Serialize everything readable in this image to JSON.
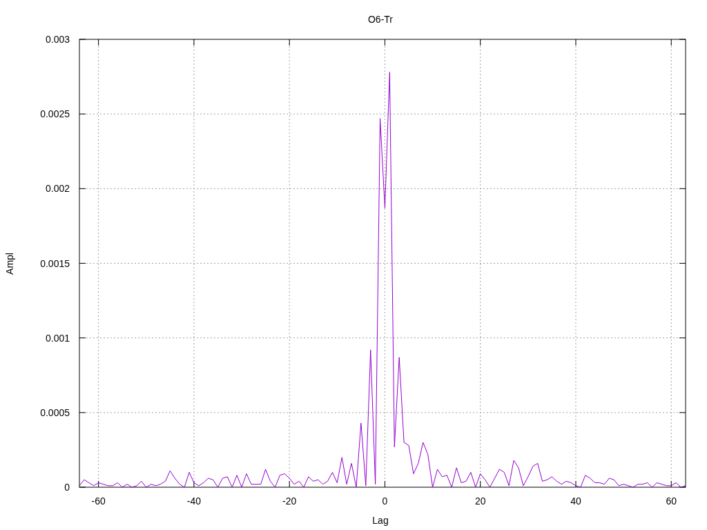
{
  "chart": {
    "chart_data": {
      "type": "line",
      "title": "O6-Tr",
      "xlabel": "Lag",
      "ylabel": "Ampl",
      "grid": true,
      "xlim": [
        -64,
        63
      ],
      "ylim": [
        0,
        0.003
      ],
      "xticks": [
        -60,
        -40,
        -20,
        0,
        20,
        40,
        60
      ],
      "yticks": [
        {
          "value": 0,
          "label": "0"
        },
        {
          "value": 0.0005,
          "label": "0.0005"
        },
        {
          "value": 0.001,
          "label": "0.001"
        },
        {
          "value": 0.0015,
          "label": "0.0015"
        },
        {
          "value": 0.002,
          "label": "0.002"
        },
        {
          "value": 0.0025,
          "label": "0.0025"
        },
        {
          "value": 0.003,
          "label": "0.003"
        }
      ],
      "x": [
        -64,
        -63,
        -62,
        -61,
        -60,
        -59,
        -58,
        -57,
        -56,
        -55,
        -54,
        -53,
        -52,
        -51,
        -50,
        -49,
        -48,
        -47,
        -46,
        -45,
        -44,
        -43,
        -42,
        -41,
        -40,
        -39,
        -38,
        -37,
        -36,
        -35,
        -34,
        -33,
        -32,
        -31,
        -30,
        -29,
        -28,
        -27,
        -26,
        -25,
        -24,
        -23,
        -22,
        -21,
        -20,
        -19,
        -18,
        -17,
        -16,
        -15,
        -14,
        -13,
        -12,
        -11,
        -10,
        -9,
        -8,
        -7,
        -6,
        -5,
        -4,
        -3,
        -2,
        -1,
        0,
        1,
        2,
        3,
        4,
        5,
        6,
        7,
        8,
        9,
        10,
        11,
        12,
        13,
        14,
        15,
        16,
        17,
        18,
        19,
        20,
        21,
        22,
        23,
        24,
        25,
        26,
        27,
        28,
        29,
        30,
        31,
        32,
        33,
        34,
        35,
        36,
        37,
        38,
        39,
        40,
        41,
        42,
        43,
        44,
        45,
        46,
        47,
        48,
        49,
        50,
        51,
        52,
        53,
        54,
        55,
        56,
        57,
        58,
        59,
        60,
        61,
        62,
        63
      ],
      "series": [
        {
          "color": "#9400d3",
          "values": [
            1e-05,
            5e-05,
            3e-05,
            1e-05,
            3e-05,
            2e-05,
            1e-05,
            1e-05,
            3e-05,
            0,
            2e-05,
            0,
            1e-05,
            4e-05,
            0,
            2e-05,
            1e-05,
            2e-05,
            4e-05,
            0.00011,
            6e-05,
            2e-05,
            0,
            0.0001,
            3e-05,
            1e-05,
            3e-05,
            6e-05,
            5e-05,
            0,
            6e-05,
            7e-05,
            0,
            8e-05,
            0,
            9e-05,
            2e-05,
            2e-05,
            2e-05,
            0.00012,
            4e-05,
            0,
            8e-05,
            9e-05,
            6e-05,
            2e-05,
            4e-05,
            0,
            7e-05,
            4e-05,
            5e-05,
            2e-05,
            4e-05,
            0.0001,
            3e-05,
            0.0002,
            2e-05,
            0.00016,
            0,
            0.00043,
            1e-05,
            0.00092,
            2e-05,
            0.00247,
            0.00187,
            0.00278,
            0.00027,
            0.00087,
            0.0003,
            0.00028,
            9e-05,
            0.00016,
            0.0003,
            0.00022,
            0,
            0.00012,
            7e-05,
            8e-05,
            0,
            0.00013,
            3e-05,
            4e-05,
            0.0001,
            0,
            9e-05,
            5e-05,
            0,
            6e-05,
            0.00012,
            0.0001,
            1e-05,
            0.00018,
            0.00013,
            1e-05,
            7e-05,
            0.00014,
            0.00016,
            4e-05,
            5e-05,
            7e-05,
            4e-05,
            2e-05,
            4e-05,
            3e-05,
            1e-05,
            0,
            8e-05,
            6e-05,
            3e-05,
            3e-05,
            2e-05,
            6e-05,
            5e-05,
            1e-05,
            2e-05,
            1e-05,
            0,
            2e-05,
            2e-05,
            3e-05,
            0,
            3e-05,
            2e-05,
            1e-05,
            1e-05,
            3e-05,
            0,
            1e-05
          ]
        }
      ]
    }
  }
}
